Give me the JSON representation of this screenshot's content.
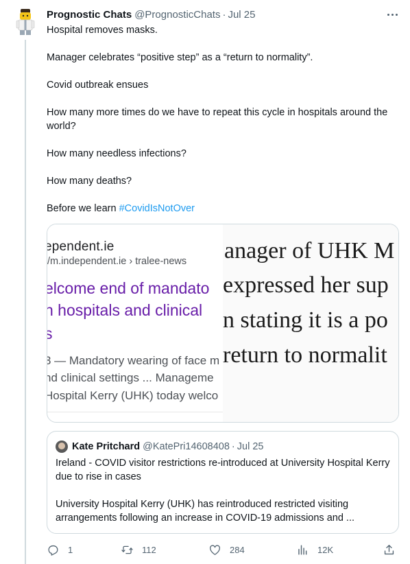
{
  "tweet": {
    "author_name": "Prognostic Chats",
    "author_handle": "@PrognosticChats",
    "separator": "·",
    "date": "Jul 25",
    "paragraphs": [
      "Hospital removes masks.",
      "Manager celebrates “positive step” as a “return to normality”.",
      "Covid outbreak ensues",
      "How many more times do we have to repeat this cycle in hospitals around the world?",
      "How many needless infections?",
      "How many deaths?"
    ],
    "last_line_prefix": "Before we learn ",
    "hashtag": "#CovidIsNotOver"
  },
  "card": {
    "left": {
      "site": "ependent.ie",
      "url": "//m.independent.ie › tralee-news",
      "title_lines": [
        "elcome end of mandato",
        "n hospitals and clinical",
        "s"
      ],
      "snippet_lines": [
        "3 — Mandatory wearing of face m",
        "nd clinical settings ... Manageme",
        "Hospital Kerry (UHK) today welco"
      ]
    },
    "right": {
      "lines": [
        "anager of UHK M",
        "expressed her sup",
        "n stating it is a po",
        "return to normalit"
      ]
    }
  },
  "quote": {
    "author_name": "Kate Pritchard",
    "author_handle": "@KatePri14608408",
    "separator": "·",
    "date": "Jul 25",
    "paragraph1": "Ireland - COVID visitor restrictions re-introduced at University Hospital Kerry due to rise in cases",
    "paragraph2": "University Hospital Kerry (UHK) has reintroduced restricted visiting arrangements following an increase in COVID-19 admissions and ..."
  },
  "actions": {
    "reply_count": "1",
    "retweet_count": "112",
    "like_count": "284",
    "views_count": "12K"
  },
  "icons": [
    "more-icon",
    "reply-icon",
    "retweet-icon",
    "like-icon",
    "views-icon",
    "share-icon"
  ],
  "colors": {
    "link": "#1d9bf0",
    "muted": "#536471",
    "visited_title": "#681da8"
  }
}
